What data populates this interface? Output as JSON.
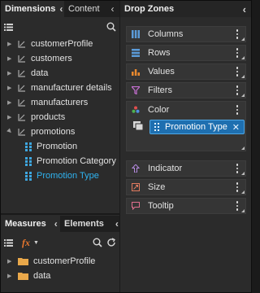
{
  "left_panel": {
    "tabs": [
      {
        "label": "Dimensions",
        "active": true
      },
      {
        "label": "Content",
        "active": false
      }
    ],
    "tree": [
      {
        "label": "customerProfile",
        "expanded": false
      },
      {
        "label": "customers",
        "expanded": false
      },
      {
        "label": "data",
        "expanded": false
      },
      {
        "label": "manufacturer details",
        "expanded": false
      },
      {
        "label": "manufacturers",
        "expanded": false
      },
      {
        "label": "products",
        "expanded": false
      },
      {
        "label": "promotions",
        "expanded": true
      }
    ],
    "promotions_attributes": [
      {
        "label": "Promotion",
        "selected": false
      },
      {
        "label": "Promotion Category",
        "selected": false
      },
      {
        "label": "Promotion Type",
        "selected": true
      }
    ],
    "bottom_tabs": [
      {
        "label": "Measures",
        "active": true
      },
      {
        "label": "Elements",
        "active": false
      }
    ],
    "bottom_tree": [
      {
        "label": "customerProfile"
      },
      {
        "label": "data"
      }
    ]
  },
  "drop_zones": {
    "title": "Drop Zones",
    "zones": [
      {
        "label": "Columns",
        "icon": "columns-icon"
      },
      {
        "label": "Rows",
        "icon": "rows-icon"
      },
      {
        "label": "Values",
        "icon": "values-icon"
      },
      {
        "label": "Filters",
        "icon": "filter-icon"
      },
      {
        "label": "Color",
        "icon": "color-icon"
      },
      {
        "label": "Indicator",
        "icon": "indicator-icon"
      },
      {
        "label": "Size",
        "icon": "size-icon"
      },
      {
        "label": "Tooltip",
        "icon": "tooltip-icon"
      }
    ],
    "color_chip": {
      "label": "Promotion Type"
    }
  },
  "colors": {
    "accent_blue": "#2fb3f0",
    "chip_bg": "#1e6fb0",
    "folder": "#e9a84a",
    "fx": "#e8772e"
  }
}
